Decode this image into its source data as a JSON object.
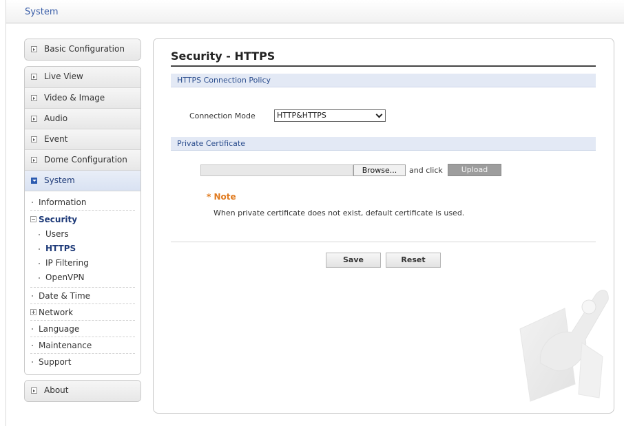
{
  "topbar": {
    "title": "System"
  },
  "sidebar": {
    "basic_config": "Basic Configuration",
    "items": [
      "Live View",
      "Video & Image",
      "Audio",
      "Event",
      "Dome Configuration",
      "System"
    ],
    "system_sub": {
      "information": "Information",
      "security": "Security",
      "security_children": [
        "Users",
        "HTTPS",
        "IP Filtering",
        "OpenVPN"
      ],
      "date_time": "Date & Time",
      "network": "Network",
      "language": "Language",
      "maintenance": "Maintenance",
      "support": "Support"
    },
    "about": "About"
  },
  "main": {
    "title": "Security - HTTPS",
    "section_policy": "HTTPS Connection Policy",
    "connection_mode_label": "Connection Mode",
    "connection_mode_value": "HTTP&HTTPS",
    "section_cert": "Private Certificate",
    "browse_label": "Browse...",
    "and_click": "and click",
    "upload_label": "Upload",
    "note_title": "* Note",
    "note_text": "When private certificate does not exist, default certificate is used.",
    "save_label": "Save",
    "reset_label": "Reset"
  },
  "colors": {
    "accent": "#3a5ea8",
    "note": "#e07a1e",
    "section_bg": "#e3e9f5",
    "upload_bg": "#9d9d9d"
  },
  "icons": [
    "expand-box-icon",
    "collapse-box-icon",
    "chevron-down-icon",
    "tools-watermark-icon"
  ]
}
